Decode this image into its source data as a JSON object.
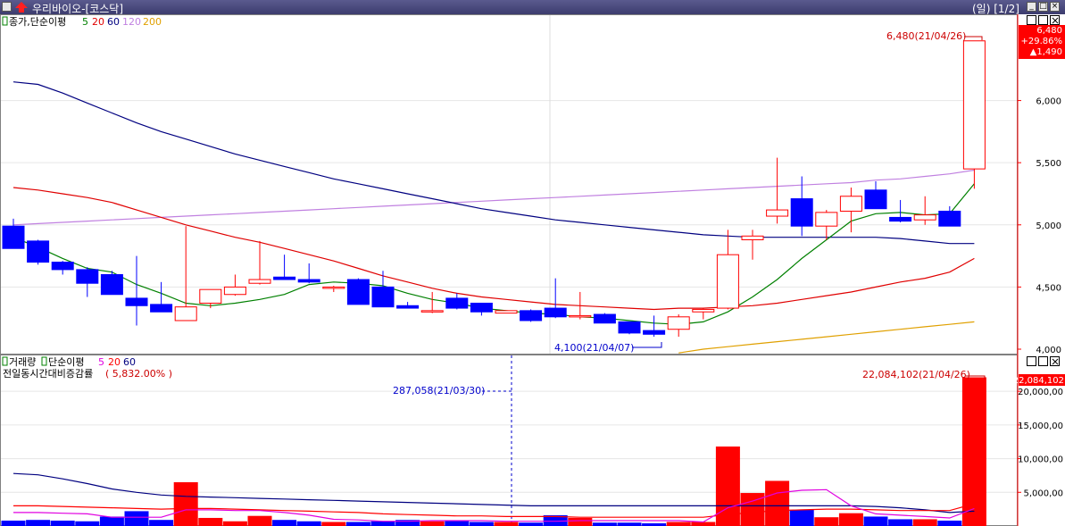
{
  "window": {
    "title": "우리바이오-[코스닥]",
    "period": "(일) [1/2]"
  },
  "colors": {
    "up": "#ff0000",
    "down": "#0000ff",
    "ma5": "#008000",
    "ma20": "#e00000",
    "ma60": "#000080",
    "ma120": "#c080e0",
    "ma200": "#e0a000",
    "vol_ma5": "#e000e0",
    "vol_ma20": "#ff0000",
    "vol_ma60": "#000080"
  },
  "price_panel": {
    "legend_title": "종가,단순이평",
    "legend_periods": [
      "5",
      "20",
      "60",
      "120",
      "200"
    ],
    "current_price": "6,480",
    "change_pct": "+29.86%",
    "change_amt": "▲1,490",
    "high_label": "6,480(21/04/26)",
    "low_label": "4,100(21/04/07)",
    "y_ticks": [
      "6,000",
      "5,500",
      "5,000",
      "4,500",
      "4,000"
    ]
  },
  "volume_panel": {
    "legend_title": "거래량",
    "legend_ma_title": "단순이평",
    "legend_periods": [
      "5",
      "20",
      "60"
    ],
    "subtitle": "전일동시간대비증감률",
    "subtitle_value": "( 5,832.00% )",
    "max_label": "22,084,102(21/04/26)",
    "current_volume": "22,084,102",
    "cursor_label": "287,058(21/03/30)",
    "y_ticks": [
      "20,000,00",
      "15,000,00",
      "10,000,00",
      "5,000,00"
    ]
  },
  "chart_data": {
    "type": "candlestick",
    "title": "우리바이오-[코스닥]",
    "candles": [
      {
        "o": 4990,
        "h": 5050,
        "l": 4810,
        "c": 4810
      },
      {
        "o": 4870,
        "h": 4880,
        "l": 4680,
        "c": 4700
      },
      {
        "o": 4700,
        "h": 4710,
        "l": 4600,
        "c": 4640
      },
      {
        "o": 4640,
        "h": 4660,
        "l": 4420,
        "c": 4530
      },
      {
        "o": 4600,
        "h": 4630,
        "l": 4440,
        "c": 4440
      },
      {
        "o": 4410,
        "h": 4750,
        "l": 4190,
        "c": 4350
      },
      {
        "o": 4360,
        "h": 4540,
        "l": 4300,
        "c": 4300
      },
      {
        "o": 4230,
        "h": 4990,
        "l": 4230,
        "c": 4340
      },
      {
        "o": 4370,
        "h": 4480,
        "l": 4330,
        "c": 4480
      },
      {
        "o": 4440,
        "h": 4600,
        "l": 4430,
        "c": 4500
      },
      {
        "o": 4530,
        "h": 4870,
        "l": 4520,
        "c": 4560
      },
      {
        "o": 4580,
        "h": 4760,
        "l": 4560,
        "c": 4560
      },
      {
        "o": 4560,
        "h": 4690,
        "l": 4530,
        "c": 4540
      },
      {
        "o": 4500,
        "h": 4510,
        "l": 4460,
        "c": 4500
      },
      {
        "o": 4560,
        "h": 4570,
        "l": 4360,
        "c": 4360
      },
      {
        "o": 4500,
        "h": 4630,
        "l": 4340,
        "c": 4340
      },
      {
        "o": 4350,
        "h": 4380,
        "l": 4330,
        "c": 4330
      },
      {
        "o": 4300,
        "h": 4460,
        "l": 4290,
        "c": 4310
      },
      {
        "o": 4410,
        "h": 4450,
        "l": 4320,
        "c": 4330
      },
      {
        "o": 4370,
        "h": 4370,
        "l": 4270,
        "c": 4300
      },
      {
        "o": 4290,
        "h": 4310,
        "l": 4290,
        "c": 4310
      },
      {
        "o": 4310,
        "h": 4320,
        "l": 4220,
        "c": 4230
      },
      {
        "o": 4330,
        "h": 4570,
        "l": 4250,
        "c": 4260
      },
      {
        "o": 4260,
        "h": 4460,
        "l": 4240,
        "c": 4270
      },
      {
        "o": 4280,
        "h": 4290,
        "l": 4210,
        "c": 4210
      },
      {
        "o": 4220,
        "h": 4220,
        "l": 4120,
        "c": 4130
      },
      {
        "o": 4150,
        "h": 4270,
        "l": 4100,
        "c": 4120
      },
      {
        "o": 4160,
        "h": 4280,
        "l": 4100,
        "c": 4260
      },
      {
        "o": 4300,
        "h": 4330,
        "l": 4240,
        "c": 4320
      },
      {
        "o": 4330,
        "h": 4960,
        "l": 4320,
        "c": 4760
      },
      {
        "o": 4880,
        "h": 4960,
        "l": 4720,
        "c": 4910
      },
      {
        "o": 5070,
        "h": 5540,
        "l": 5010,
        "c": 5120
      },
      {
        "o": 5210,
        "h": 5390,
        "l": 4910,
        "c": 4990
      },
      {
        "o": 4990,
        "h": 5120,
        "l": 4880,
        "c": 5100
      },
      {
        "o": 5110,
        "h": 5300,
        "l": 4940,
        "c": 5230
      },
      {
        "o": 5280,
        "h": 5350,
        "l": 5130,
        "c": 5130
      },
      {
        "o": 5060,
        "h": 5200,
        "l": 5020,
        "c": 5030
      },
      {
        "o": 5040,
        "h": 5230,
        "l": 5000,
        "c": 5080
      },
      {
        "o": 5110,
        "h": 5150,
        "l": 4990,
        "c": 4990
      },
      {
        "o": 5450,
        "h": 6480,
        "l": 5290,
        "c": 6480
      }
    ],
    "ma5": [
      4900,
      4820,
      4730,
      4650,
      4620,
      4520,
      4450,
      4370,
      4350,
      4370,
      4400,
      4440,
      4520,
      4540,
      4530,
      4510,
      4450,
      4400,
      4370,
      4330,
      4310,
      4290,
      4280,
      4260,
      4250,
      4230,
      4210,
      4200,
      4220,
      4300,
      4420,
      4560,
      4730,
      4880,
      5030,
      5090,
      5100,
      5080,
      5090,
      5330
    ],
    "ma20": [
      5300,
      5280,
      5250,
      5220,
      5180,
      5120,
      5060,
      5000,
      4950,
      4900,
      4860,
      4810,
      4760,
      4710,
      4650,
      4590,
      4540,
      4490,
      4450,
      4420,
      4400,
      4380,
      4360,
      4350,
      4340,
      4330,
      4320,
      4330,
      4330,
      4340,
      4350,
      4370,
      4400,
      4430,
      4460,
      4500,
      4540,
      4570,
      4620,
      4730
    ],
    "ma60": [
      6150,
      6130,
      6060,
      5980,
      5900,
      5820,
      5750,
      5690,
      5630,
      5570,
      5520,
      5470,
      5420,
      5370,
      5330,
      5290,
      5250,
      5210,
      5170,
      5130,
      5100,
      5070,
      5040,
      5020,
      5000,
      4980,
      4960,
      4940,
      4920,
      4910,
      4900,
      4900,
      4900,
      4900,
      4900,
      4900,
      4890,
      4870,
      4850,
      4850
    ],
    "ma120": [
      5000,
      5010,
      5020,
      5030,
      5040,
      5050,
      5060,
      5070,
      5080,
      5090,
      5100,
      5110,
      5120,
      5130,
      5140,
      5150,
      5160,
      5170,
      5180,
      5190,
      5200,
      5210,
      5220,
      5230,
      5240,
      5250,
      5260,
      5270,
      5280,
      5290,
      5300,
      5310,
      5320,
      5330,
      5340,
      5360,
      5370,
      5390,
      5410,
      5440
    ],
    "ma200": [
      null,
      null,
      null,
      null,
      null,
      null,
      null,
      null,
      null,
      null,
      null,
      null,
      null,
      null,
      null,
      null,
      null,
      null,
      null,
      null,
      null,
      null,
      null,
      null,
      null,
      null,
      null,
      3970,
      4000,
      4020,
      4040,
      4060,
      4080,
      4100,
      4120,
      4140,
      4160,
      4180,
      4200,
      4220
    ],
    "volume": [
      0.8,
      0.9,
      0.8,
      0.7,
      1.4,
      2.2,
      0.9,
      6.5,
      1.2,
      0.7,
      1.5,
      0.9,
      0.7,
      0.6,
      0.6,
      0.7,
      0.9,
      0.7,
      0.8,
      0.6,
      0.6,
      0.5,
      1.6,
      1.2,
      0.5,
      0.5,
      0.4,
      0.6,
      0.6,
      11.8,
      4.9,
      6.7,
      2.4,
      1.3,
      1.9,
      1.4,
      1.0,
      1.0,
      0.8,
      22.08
    ],
    "volume_units": "millions",
    "vol_ma5": [
      2.0,
      2.0,
      1.9,
      1.8,
      1.3,
      1.3,
      1.3,
      2.4,
      2.4,
      2.3,
      2.3,
      2.0,
      1.6,
      1.0,
      0.9,
      0.7,
      0.7,
      0.8,
      0.8,
      0.8,
      0.7,
      0.7,
      0.7,
      0.8,
      0.8,
      0.8,
      0.8,
      0.8,
      0.6,
      2.7,
      3.7,
      4.9,
      5.3,
      5.4,
      3.0,
      1.8,
      1.6,
      1.4,
      1.2,
      2.6
    ],
    "vol_ma20": [
      3.0,
      3.0,
      2.9,
      2.8,
      2.7,
      2.6,
      2.5,
      2.6,
      2.6,
      2.5,
      2.4,
      2.3,
      2.2,
      2.1,
      2.0,
      1.8,
      1.7,
      1.6,
      1.5,
      1.5,
      1.4,
      1.4,
      1.4,
      1.3,
      1.3,
      1.3,
      1.3,
      1.3,
      1.3,
      1.7,
      2.0,
      2.3,
      2.4,
      2.5,
      2.5,
      2.4,
      2.3,
      2.3,
      2.3,
      3.3
    ],
    "vol_ma60": [
      7.8,
      7.6,
      7.0,
      6.3,
      5.5,
      5.0,
      4.6,
      4.4,
      4.3,
      4.2,
      4.1,
      4.0,
      3.9,
      3.8,
      3.7,
      3.6,
      3.5,
      3.4,
      3.3,
      3.2,
      3.1,
      3.0,
      3.0,
      3.0,
      3.0,
      3.0,
      3.0,
      3.0,
      3.0,
      3.0,
      3.0,
      3.0,
      3.0,
      3.0,
      3.0,
      2.9,
      2.7,
      2.4,
      2.0,
      2.2
    ],
    "price_ylim": [
      4000,
      6550
    ],
    "volume_ylim": [
      0,
      24
    ]
  }
}
